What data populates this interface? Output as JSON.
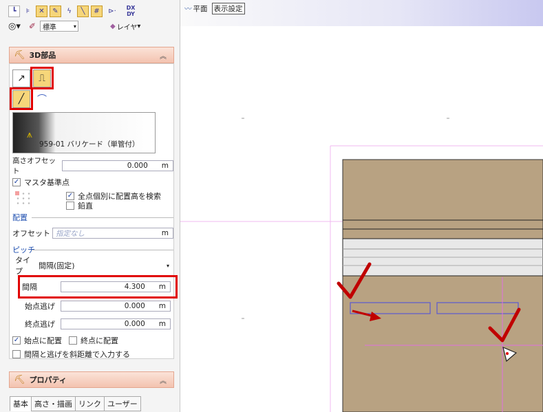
{
  "toolbar": {
    "row1_icons": [
      "corner-select-icon",
      "trim-icon",
      "cross-box-icon",
      "pencil-icon",
      "lightning-icon",
      "diagonal-line-icon",
      "grid-icon",
      "arrow-dash-icon",
      "dx-dy-icon"
    ],
    "dx_label": "DX",
    "dy_label": "DY",
    "row2": {
      "line_style_value": "標準",
      "layer_label": "レイヤ"
    }
  },
  "canvas_tabs": {
    "plan_label": "平面",
    "display_settings_label": "表示設定"
  },
  "section_3d": {
    "title": "3D部品",
    "part_name": "959-01 バリケード（単管付）",
    "height_offset_label": "高さオフセット",
    "height_offset_value": "0.000",
    "unit_m": "m",
    "master_ref_label": "マスタ基準点",
    "search_each_label": "全点個別に配置高を検索",
    "vertical_label": "鉛直",
    "placement_group": "配置",
    "offset_label": "オフセット",
    "offset_placeholder": "指定なし",
    "pitch_group": "ピッチ",
    "type_label": "タイプ",
    "type_value": "間隔(固定)",
    "interval_label": "間隔",
    "interval_value": "4.300",
    "start_escape_label": "始点逃げ",
    "start_escape_value": "0.000",
    "end_escape_label": "終点逃げ",
    "end_escape_value": "0.000",
    "place_at_start_label": "始点に配置",
    "place_at_end_label": "終点に配置",
    "input_as_slope_label": "間隔と逃げを斜距離で入力する"
  },
  "section_props": {
    "title": "プロパティ",
    "tabs": [
      "基本",
      "高さ・描画",
      "リンク",
      "ユーザー"
    ]
  },
  "colors": {
    "accent_red": "#e10000",
    "road_brown": "#b8a282",
    "guide_magenta": "#e070e0",
    "blue_rect": "#5a5ad0"
  }
}
